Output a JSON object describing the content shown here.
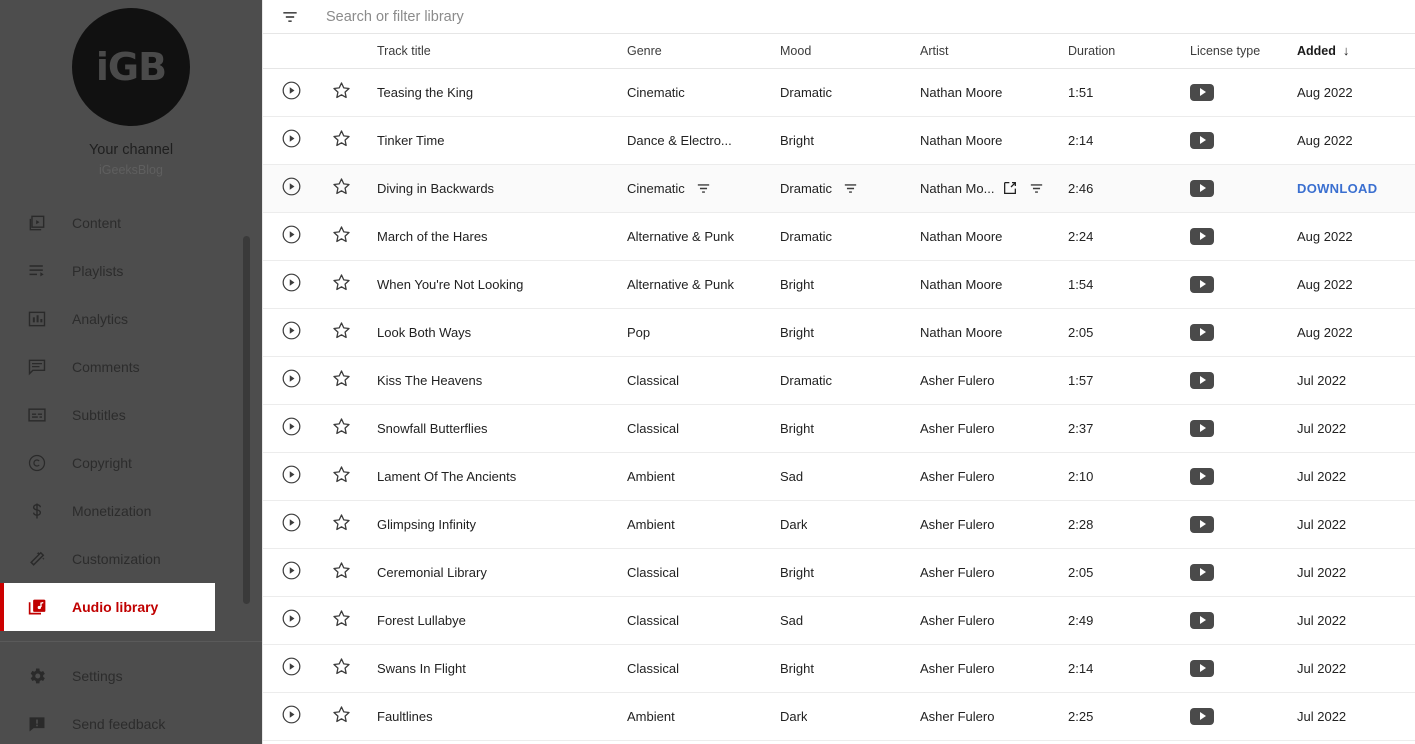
{
  "sidebar": {
    "avatar_text": "iGB",
    "channel_label": "Your channel",
    "channel_handle": "iGeeksBlog",
    "items": [
      {
        "label": "Content",
        "icon": "content-icon"
      },
      {
        "label": "Playlists",
        "icon": "playlists-icon"
      },
      {
        "label": "Analytics",
        "icon": "analytics-icon"
      },
      {
        "label": "Comments",
        "icon": "comments-icon"
      },
      {
        "label": "Subtitles",
        "icon": "subtitles-icon"
      },
      {
        "label": "Copyright",
        "icon": "copyright-icon"
      },
      {
        "label": "Monetization",
        "icon": "monetization-icon"
      },
      {
        "label": "Customization",
        "icon": "customization-icon"
      },
      {
        "label": "Audio library",
        "icon": "audio-library-icon",
        "active": true
      }
    ],
    "bottom_items": [
      {
        "label": "Settings",
        "icon": "gear-icon"
      },
      {
        "label": "Send feedback",
        "icon": "feedback-icon"
      }
    ],
    "active_accent": "#cc0000"
  },
  "search": {
    "placeholder": "Search or filter library",
    "icon": "filter-icon"
  },
  "table": {
    "columns": [
      {
        "key": "play",
        "label": ""
      },
      {
        "key": "star",
        "label": ""
      },
      {
        "key": "title",
        "label": "Track title"
      },
      {
        "key": "genre",
        "label": "Genre"
      },
      {
        "key": "mood",
        "label": "Mood"
      },
      {
        "key": "artist",
        "label": "Artist"
      },
      {
        "key": "duration",
        "label": "Duration"
      },
      {
        "key": "license",
        "label": "License type"
      },
      {
        "key": "added",
        "label": "Added"
      }
    ],
    "sorted_column": "Added",
    "sort_direction_icon": "↓",
    "license_icon": "youtube-badge-icon",
    "hover_download_label": "DOWNLOAD",
    "download_color": "#3a6fd0",
    "rows": [
      {
        "title": "Teasing the King",
        "genre": "Cinematic",
        "mood": "Dramatic",
        "artist": "Nathan Moore",
        "duration": "1:51",
        "added": "Aug 2022"
      },
      {
        "title": "Tinker Time",
        "genre": "Dance & Electro...",
        "mood": "Bright",
        "artist": "Nathan Moore",
        "duration": "2:14",
        "added": "Aug 2022"
      },
      {
        "title": "Diving in Backwards",
        "genre": "Cinematic",
        "mood": "Dramatic",
        "artist": "Nathan Mo...",
        "duration": "2:46",
        "added": "DOWNLOAD",
        "hovered": true
      },
      {
        "title": "March of the Hares",
        "genre": "Alternative & Punk",
        "mood": "Dramatic",
        "artist": "Nathan Moore",
        "duration": "2:24",
        "added": "Aug 2022"
      },
      {
        "title": "When You're Not Looking",
        "genre": "Alternative & Punk",
        "mood": "Bright",
        "artist": "Nathan Moore",
        "duration": "1:54",
        "added": "Aug 2022"
      },
      {
        "title": "Look Both Ways",
        "genre": "Pop",
        "mood": "Bright",
        "artist": "Nathan Moore",
        "duration": "2:05",
        "added": "Aug 2022"
      },
      {
        "title": "Kiss The Heavens",
        "genre": "Classical",
        "mood": "Dramatic",
        "artist": "Asher Fulero",
        "duration": "1:57",
        "added": "Jul 2022"
      },
      {
        "title": "Snowfall Butterflies",
        "genre": "Classical",
        "mood": "Bright",
        "artist": "Asher Fulero",
        "duration": "2:37",
        "added": "Jul 2022"
      },
      {
        "title": "Lament Of The Ancients",
        "genre": "Ambient",
        "mood": "Sad",
        "artist": "Asher Fulero",
        "duration": "2:10",
        "added": "Jul 2022"
      },
      {
        "title": "Glimpsing Infinity",
        "genre": "Ambient",
        "mood": "Dark",
        "artist": "Asher Fulero",
        "duration": "2:28",
        "added": "Jul 2022"
      },
      {
        "title": "Ceremonial Library",
        "genre": "Classical",
        "mood": "Bright",
        "artist": "Asher Fulero",
        "duration": "2:05",
        "added": "Jul 2022"
      },
      {
        "title": "Forest Lullabye",
        "genre": "Classical",
        "mood": "Sad",
        "artist": "Asher Fulero",
        "duration": "2:49",
        "added": "Jul 2022"
      },
      {
        "title": "Swans In Flight",
        "genre": "Classical",
        "mood": "Bright",
        "artist": "Asher Fulero",
        "duration": "2:14",
        "added": "Jul 2022"
      },
      {
        "title": "Faultlines",
        "genre": "Ambient",
        "mood": "Dark",
        "artist": "Asher Fulero",
        "duration": "2:25",
        "added": "Jul 2022"
      }
    ]
  }
}
